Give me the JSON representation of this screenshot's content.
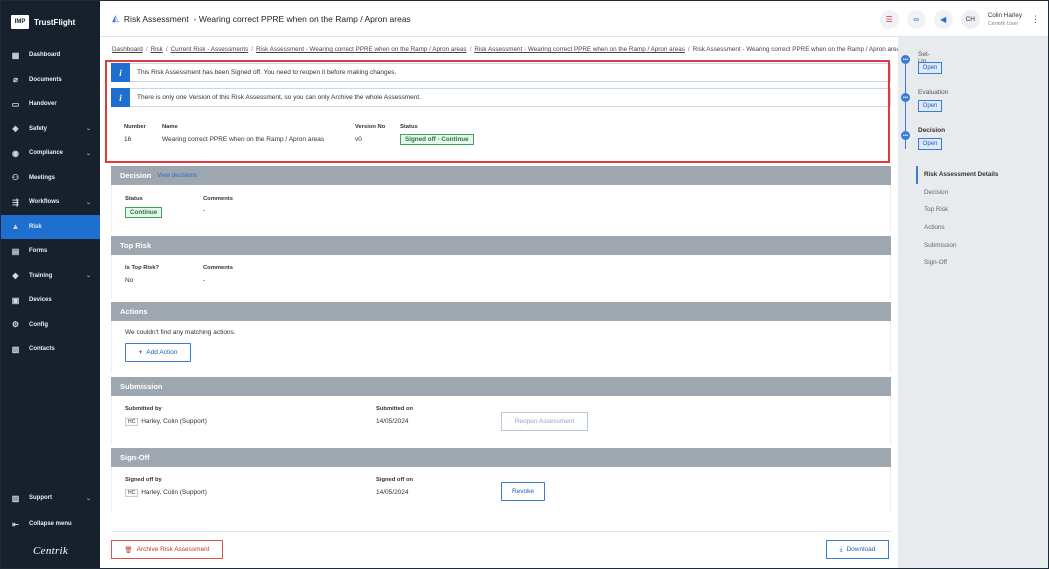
{
  "brand": {
    "logo": "IMP",
    "name": "TrustFlight"
  },
  "sidebar": {
    "items": [
      {
        "label": "Dashboard",
        "icon": "dashboard-icon",
        "glyph": "▦",
        "chevron": false,
        "active": false
      },
      {
        "label": "Documents",
        "icon": "paperclip-icon",
        "glyph": "⌀",
        "chevron": false,
        "active": false
      },
      {
        "label": "Handover",
        "icon": "handover-icon",
        "glyph": "▭",
        "chevron": false,
        "active": false
      },
      {
        "label": "Safety",
        "icon": "shield-icon",
        "glyph": "◈",
        "chevron": true,
        "active": false
      },
      {
        "label": "Compliance",
        "icon": "compliance-icon",
        "glyph": "◉",
        "chevron": true,
        "active": false
      },
      {
        "label": "Meetings",
        "icon": "meetings-icon",
        "glyph": "⚇",
        "chevron": false,
        "active": false
      },
      {
        "label": "Workflows",
        "icon": "workflows-icon",
        "glyph": "⇶",
        "chevron": true,
        "active": false
      },
      {
        "label": "Risk",
        "icon": "risk-icon",
        "glyph": "▲",
        "chevron": false,
        "active": true
      },
      {
        "label": "Forms",
        "icon": "forms-icon",
        "glyph": "▤",
        "chevron": false,
        "active": false
      },
      {
        "label": "Training",
        "icon": "graduation-cap-icon",
        "glyph": "◆",
        "chevron": true,
        "active": false
      },
      {
        "label": "Devices",
        "icon": "devices-icon",
        "glyph": "▣",
        "chevron": false,
        "active": false
      },
      {
        "label": "Config",
        "icon": "gear-icon",
        "glyph": "⚙",
        "chevron": false,
        "active": false
      },
      {
        "label": "Contacts",
        "icon": "contacts-icon",
        "glyph": "▧",
        "chevron": false,
        "active": false
      }
    ],
    "support": "Support",
    "collapse": "Collapse menu",
    "footer_logo": "Centrik"
  },
  "topbar": {
    "title": "Risk Assessment",
    "subtitle": "- Wearing correct PPRE when on the Ramp / Apron areas",
    "user_initials": "CH",
    "user_name": "Colin Harley",
    "user_role": "Centrik User"
  },
  "breadcrumb": [
    {
      "label": "Dashboard",
      "link": true
    },
    {
      "label": "Risk",
      "link": true
    },
    {
      "label": "Current Risk - Assessments",
      "link": true
    },
    {
      "label": "Risk Assessment - Wearing correct PPRE when on the Ramp / Apron areas",
      "link": true
    },
    {
      "label": "Risk Assessment - Wearing correct PPRE when on the Ramp / Apron areas",
      "link": true
    },
    {
      "label": "Risk Assessment - Wearing correct PPRE when on the Ramp / Apron areas",
      "link": false
    }
  ],
  "alerts": [
    "This Risk Assessment has been Signed off. You need to reopen it before making changes.",
    "There is only one Version of this Risk Assessment, so you can only Archive the whole Assessment."
  ],
  "summary": {
    "number_label": "Number",
    "number": "16",
    "name_label": "Name",
    "name": "Wearing correct PPRE when on the Ramp / Apron areas",
    "version_label": "Version No",
    "version": "v0",
    "status_label": "Status",
    "status": "Signed off - Continue"
  },
  "decision": {
    "title": "Decision",
    "link": "View decisions",
    "status_label": "Status",
    "status": "Continue",
    "comments_label": "Comments",
    "comments": "-"
  },
  "top_risk": {
    "title": "Top Risk",
    "is_top_label": "Is Top Risk?",
    "is_top": "No",
    "comments_label": "Comments",
    "comments": "-"
  },
  "actions": {
    "title": "Actions",
    "empty": "We couldn't find any matching actions.",
    "add": "Add Action"
  },
  "submission": {
    "title": "Submission",
    "by_label": "Submitted by",
    "by_initials": "HC",
    "by": "Harley, Colin (Support)",
    "on_label": "Submitted on",
    "on": "14/05/2024",
    "reopen": "Reopen Assessment"
  },
  "signoff": {
    "title": "Sign-Off",
    "by_label": "Signed off by",
    "by_initials": "HC",
    "by": "Harley, Colin (Support)",
    "on_label": "Signed off on",
    "on": "14/05/2024",
    "revoke": "Revoke"
  },
  "footer": {
    "archive": "Archive Risk Assessment",
    "download": "Download"
  },
  "stepper": [
    {
      "label": "Set-Up",
      "open": "Open",
      "bold": false
    },
    {
      "label": "Evaluation",
      "open": "Open",
      "bold": false
    },
    {
      "label": "Decision",
      "open": "Open",
      "bold": true
    }
  ],
  "subnav": [
    "Risk Assessment Details",
    "Decision",
    "Top Risk",
    "Actions",
    "Submission",
    "Sign-Off"
  ],
  "colors": {
    "accent": "#1e6fd0",
    "highlight": "#e03a3a",
    "sidebar": "#16212d",
    "success": "#3ca55c"
  }
}
